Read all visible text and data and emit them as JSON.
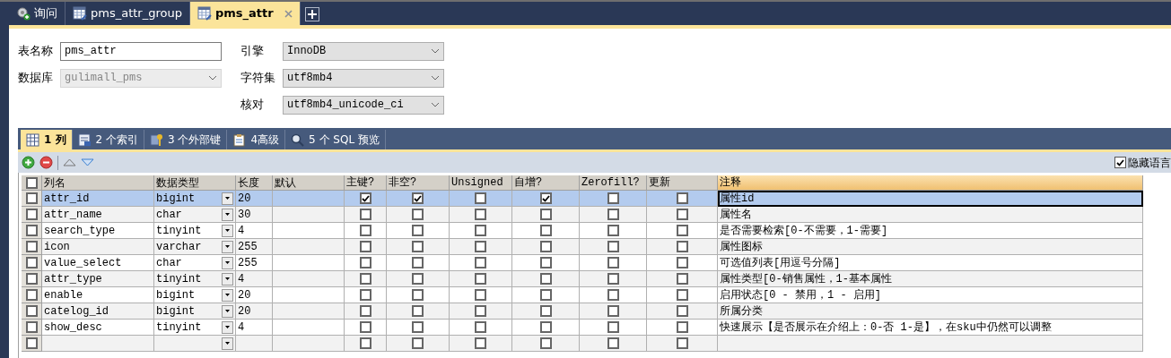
{
  "tabs": [
    {
      "kind": "query",
      "label": "询问",
      "selected": false,
      "closable": false
    },
    {
      "kind": "table",
      "label": "pms_attr_group",
      "selected": false,
      "closable": false
    },
    {
      "kind": "table",
      "label": "pms_attr",
      "selected": true,
      "closable": true
    }
  ],
  "form": {
    "left": [
      {
        "kind": "text",
        "label": "表名称",
        "value": "pms_attr"
      },
      {
        "kind": "select",
        "label": "数据库",
        "value": "gulimall_pms",
        "disabled": true
      }
    ],
    "right": [
      {
        "kind": "select",
        "label": "引擎",
        "value": "InnoDB"
      },
      {
        "kind": "select",
        "label": "字符集",
        "value": "utf8mb4"
      },
      {
        "kind": "select",
        "label": "核对",
        "value": "utf8mb4_unicode_ci"
      }
    ]
  },
  "sub_tabs": [
    {
      "kind": "columns",
      "label": "1 列",
      "selected": true
    },
    {
      "kind": "indexes",
      "label": "2 个索引",
      "selected": false
    },
    {
      "kind": "foreign_keys",
      "label": "3 个外部键",
      "selected": false
    },
    {
      "kind": "advanced",
      "label": "4高级",
      "selected": false
    },
    {
      "kind": "sql",
      "label": "5 个 SQL 预览",
      "selected": false
    }
  ],
  "hide_language": {
    "label": "隐藏语言",
    "checked": true
  },
  "table": {
    "all_checked": false,
    "columns": [
      {
        "kind": "name",
        "label": "列名",
        "selected": false
      },
      {
        "kind": "type",
        "label": "数据类型",
        "selected": false
      },
      {
        "kind": "length",
        "label": "长度",
        "selected": false
      },
      {
        "kind": "default",
        "label": "默认",
        "selected": false
      },
      {
        "kind": "flag",
        "label": "主键?",
        "selected": false
      },
      {
        "kind": "flag",
        "label": "非空?",
        "selected": false
      },
      {
        "kind": "flag",
        "label": "Unsigned",
        "selected": false
      },
      {
        "kind": "flag",
        "label": "自增?",
        "selected": false
      },
      {
        "kind": "flag",
        "label": "Zerofill?",
        "selected": false
      },
      {
        "kind": "flag",
        "label": "更新",
        "selected": false
      },
      {
        "kind": "comment",
        "label": "注释",
        "selected": true
      }
    ],
    "rows": [
      {
        "selected": true,
        "checked": false,
        "name": "attr_id",
        "type": "bigint",
        "length": "20",
        "flags": [
          true,
          true,
          false,
          true,
          false,
          false
        ],
        "comment": "属性id"
      },
      {
        "selected": false,
        "checked": false,
        "name": "attr_name",
        "type": "char",
        "length": "30",
        "flags": [
          false,
          false,
          false,
          false,
          false,
          false
        ],
        "comment": "属性名"
      },
      {
        "selected": false,
        "checked": false,
        "name": "search_type",
        "type": "tinyint",
        "length": "4",
        "flags": [
          false,
          false,
          false,
          false,
          false,
          false
        ],
        "comment": "是否需要检索[0-不需要，1-需要]"
      },
      {
        "selected": false,
        "checked": false,
        "name": "icon",
        "type": "varchar",
        "length": "255",
        "flags": [
          false,
          false,
          false,
          false,
          false,
          false
        ],
        "comment": "属性图标"
      },
      {
        "selected": false,
        "checked": false,
        "name": "value_select",
        "type": "char",
        "length": "255",
        "flags": [
          false,
          false,
          false,
          false,
          false,
          false
        ],
        "comment": "可选值列表[用逗号分隔]"
      },
      {
        "selected": false,
        "checked": false,
        "name": "attr_type",
        "type": "tinyint",
        "length": "4",
        "flags": [
          false,
          false,
          false,
          false,
          false,
          false
        ],
        "comment": "属性类型[0-销售属性，1-基本属性"
      },
      {
        "selected": false,
        "checked": false,
        "name": "enable",
        "type": "bigint",
        "length": "20",
        "flags": [
          false,
          false,
          false,
          false,
          false,
          false
        ],
        "comment": "启用状态[0 - 禁用，1 - 启用]"
      },
      {
        "selected": false,
        "checked": false,
        "name": "catelog_id",
        "type": "bigint",
        "length": "20",
        "flags": [
          false,
          false,
          false,
          false,
          false,
          false
        ],
        "comment": "所属分类"
      },
      {
        "selected": false,
        "checked": false,
        "name": "show_desc",
        "type": "tinyint",
        "length": "4",
        "flags": [
          false,
          false,
          false,
          false,
          false,
          false
        ],
        "comment": "快速展示【是否展示在介绍上：0-否 1-是】，在sku中仍然可以调整"
      },
      {
        "selected": false,
        "checked": false,
        "flags": [
          false,
          false,
          false,
          false,
          false,
          false
        ]
      }
    ]
  }
}
